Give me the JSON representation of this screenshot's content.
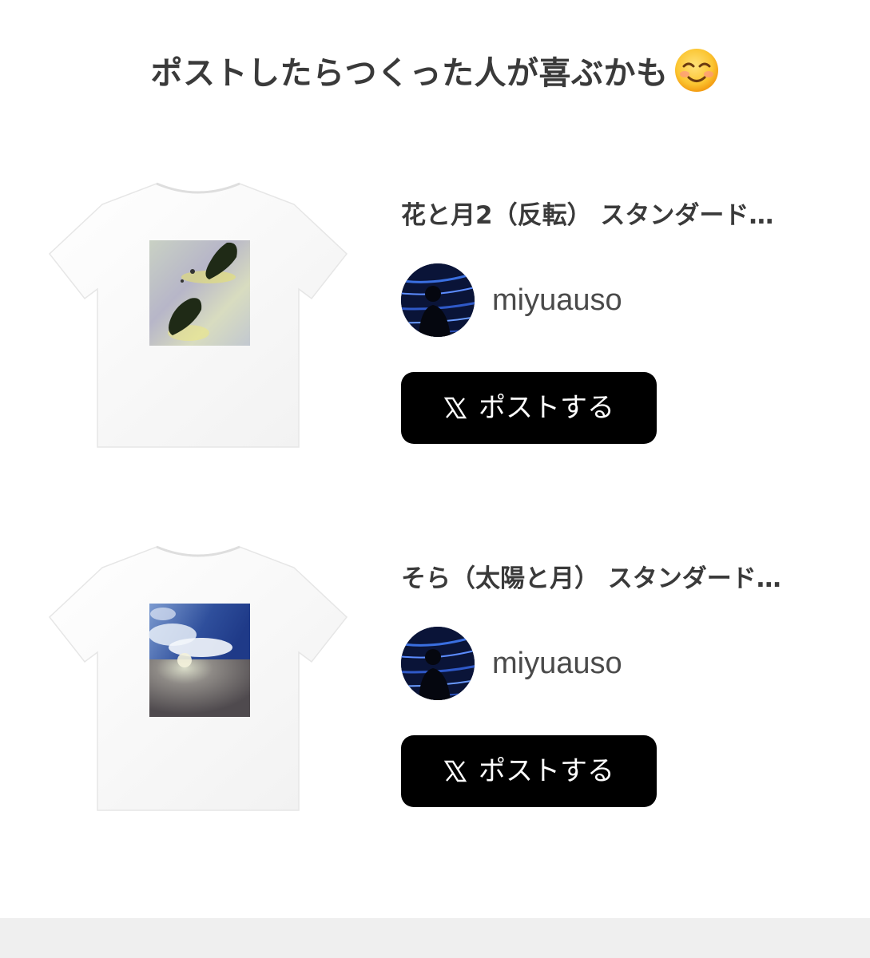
{
  "header": {
    "title": "ポストしたらつくった人が喜ぶかも",
    "emoji_icon": "smiling-face-icon"
  },
  "items": [
    {
      "title": "花と月2（反転） スタンダード…",
      "creator": "miyuauso",
      "button_label": "ポストする",
      "button_icon": "x-logo-icon"
    },
    {
      "title": "そら（太陽と月） スタンダード…",
      "creator": "miyuauso",
      "button_label": "ポストする",
      "button_icon": "x-logo-icon"
    }
  ],
  "colors": {
    "button_bg": "#000000",
    "button_text": "#ffffff",
    "text": "#3a3a3a",
    "footer_bg": "#efefef"
  }
}
